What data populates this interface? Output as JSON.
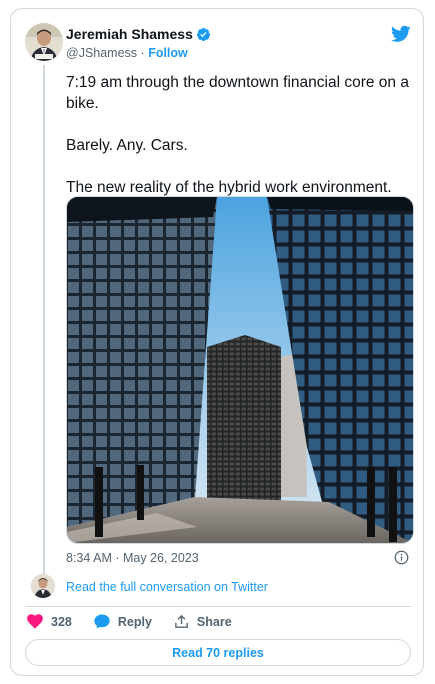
{
  "author": {
    "name": "Jeremiah Shamess",
    "handle": "@JShamess",
    "separator": "·",
    "follow_label": "Follow",
    "verified_icon": "verified-badge-icon"
  },
  "tweet": {
    "paragraphs": [
      "7:19 am through the downtown financial core on a bike.",
      "Barely. Any. Cars.",
      "The new reality of the hybrid work environment."
    ],
    "timestamp": "8:34 AM · May 26, 2023"
  },
  "conversation": {
    "read_full_label": "Read the full conversation on Twitter"
  },
  "actions": {
    "likes_count": "328",
    "reply_label": "Reply",
    "share_label": "Share"
  },
  "replies": {
    "button_label": "Read 70 replies"
  },
  "colors": {
    "accent": "#1d9bf0",
    "like": "#f91880",
    "text": "#0f1419",
    "muted": "#536471",
    "border": "#cfd9de"
  }
}
